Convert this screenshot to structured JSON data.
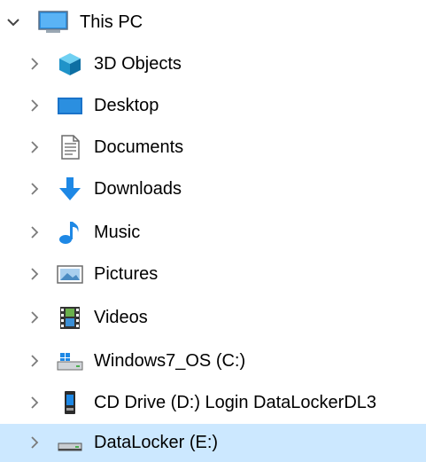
{
  "tree": {
    "root": {
      "label": "This PC",
      "icon": "this-pc-icon",
      "expanded": true
    },
    "items": [
      {
        "label": "3D Objects",
        "icon": "3d-objects-icon"
      },
      {
        "label": "Desktop",
        "icon": "desktop-icon"
      },
      {
        "label": "Documents",
        "icon": "documents-icon"
      },
      {
        "label": "Downloads",
        "icon": "downloads-icon"
      },
      {
        "label": "Music",
        "icon": "music-icon"
      },
      {
        "label": "Pictures",
        "icon": "pictures-icon"
      },
      {
        "label": "Videos",
        "icon": "videos-icon"
      },
      {
        "label": "Windows7_OS (C:)",
        "icon": "windows-drive-icon"
      },
      {
        "label": "CD Drive (D:) Login DataLockerDL3",
        "icon": "cd-drive-icon"
      },
      {
        "label": "DataLocker (E:)",
        "icon": "usb-drive-icon",
        "selected": true
      }
    ]
  },
  "colors": {
    "selection": "#cce8ff",
    "chevron": "#555555",
    "accent_blue": "#1e88e5"
  }
}
